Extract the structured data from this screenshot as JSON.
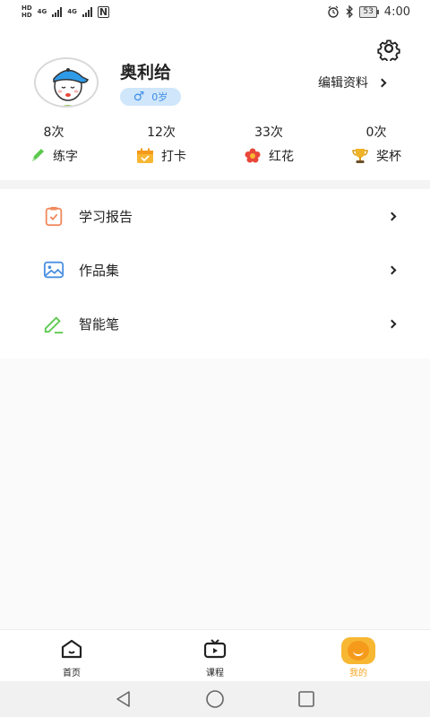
{
  "status_bar": {
    "hd_1": "HD",
    "hd_2": "HD",
    "net_1": "4G",
    "net_2": "4G",
    "nfc": "N",
    "battery": "53",
    "time": "4:00"
  },
  "profile": {
    "name": "奥利给",
    "age": "0岁",
    "edit_label": "编辑资料"
  },
  "stats": [
    {
      "count": "8次",
      "label": "练字",
      "icon": "pencil-icon",
      "color": "#5cc94e"
    },
    {
      "count": "12次",
      "label": "打卡",
      "icon": "calendar-check-icon",
      "color": "#f7b733"
    },
    {
      "count": "33次",
      "label": "红花",
      "icon": "red-flower-icon",
      "color": "#e9473a"
    },
    {
      "count": "0次",
      "label": "奖杯",
      "icon": "trophy-icon",
      "color": "#f0b429"
    }
  ],
  "menu": [
    {
      "label": "学习报告",
      "icon": "clipboard-check-icon",
      "color": "#f08a5d"
    },
    {
      "label": "作品集",
      "icon": "image-icon",
      "color": "#4a90e2"
    },
    {
      "label": "智能笔",
      "icon": "smart-pen-icon",
      "color": "#5cc94e"
    }
  ],
  "tabs": [
    {
      "label": "首页",
      "icon": "home-icon",
      "active": false
    },
    {
      "label": "课程",
      "icon": "tv-icon",
      "active": false
    },
    {
      "label": "我的",
      "icon": "smiley-face-icon",
      "active": true
    }
  ],
  "colors": {
    "accent": "#f5a623",
    "badge_bg": "#cfe6fb",
    "badge_text": "#3f8ee6"
  }
}
